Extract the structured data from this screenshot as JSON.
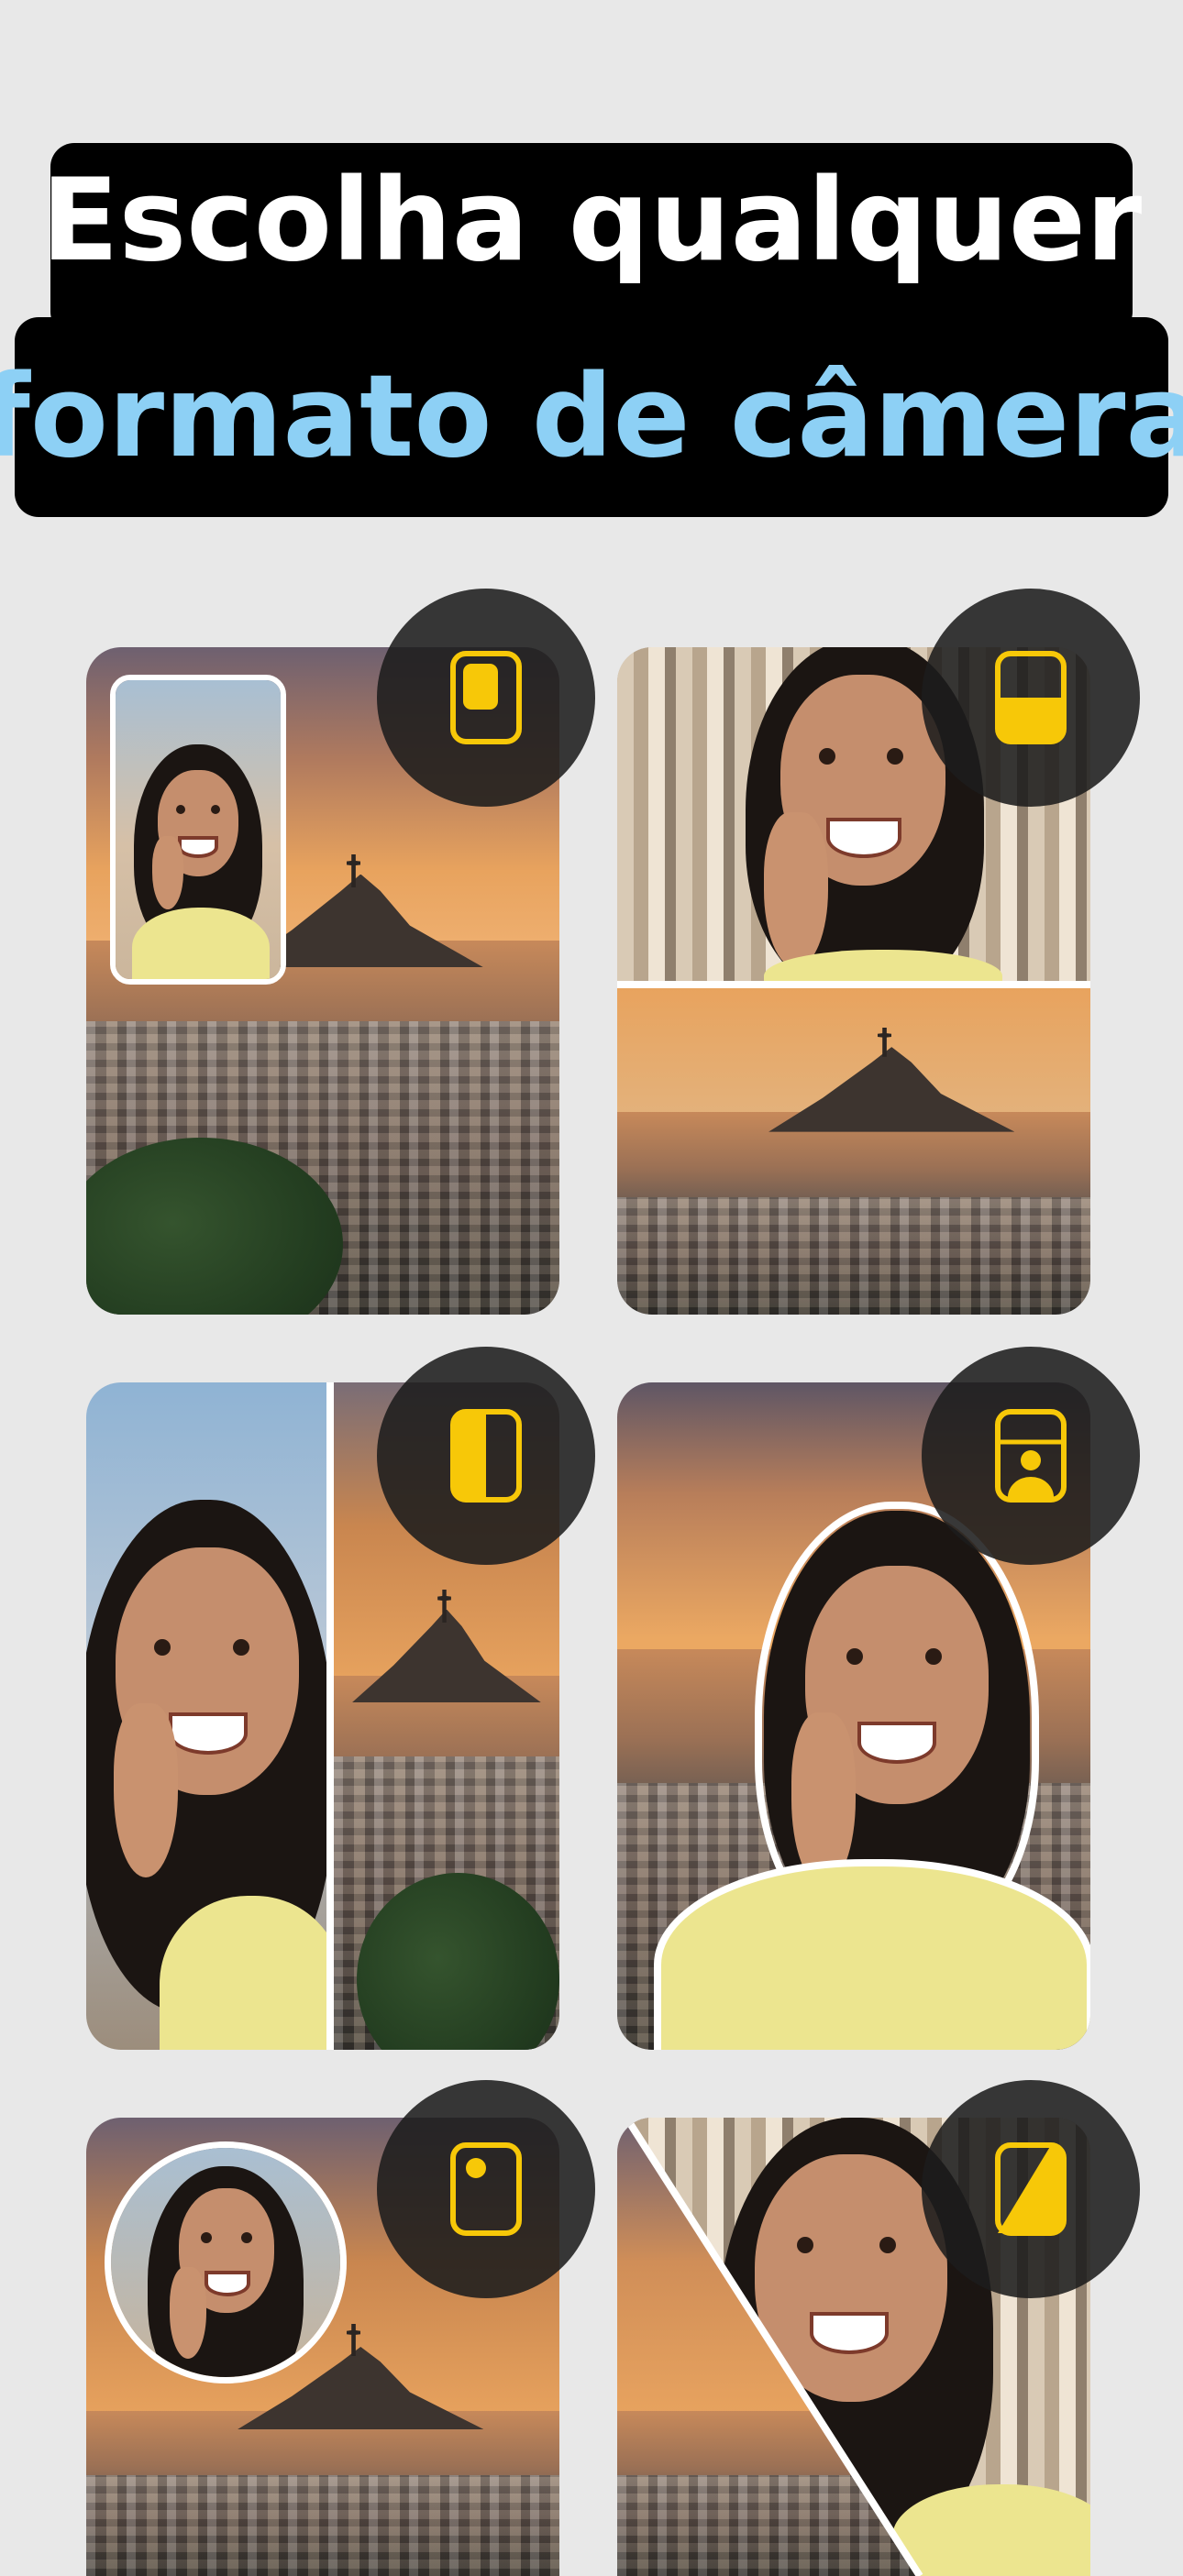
{
  "headline": {
    "line1": "Escolha qualquer",
    "line2": "formato de câmera"
  },
  "colors": {
    "background": "#e8e8e8",
    "headline_bg": "#000000",
    "line1_text": "#ffffff",
    "line2_text": "#8dd0f5",
    "badge_bg": "#1c1c1c",
    "icon_yellow": "#f7c808"
  },
  "layouts": [
    {
      "name": "picture-in-picture",
      "icon": "pip-rectangle-icon"
    },
    {
      "name": "split-top-bottom",
      "icon": "split-horizontal-icon"
    },
    {
      "name": "split-left-right",
      "icon": "split-vertical-icon"
    },
    {
      "name": "cutout-portrait",
      "icon": "person-cutout-icon"
    },
    {
      "name": "circle-bubble",
      "icon": "circle-bubble-icon"
    },
    {
      "name": "diagonal-split",
      "icon": "diagonal-split-icon"
    }
  ]
}
